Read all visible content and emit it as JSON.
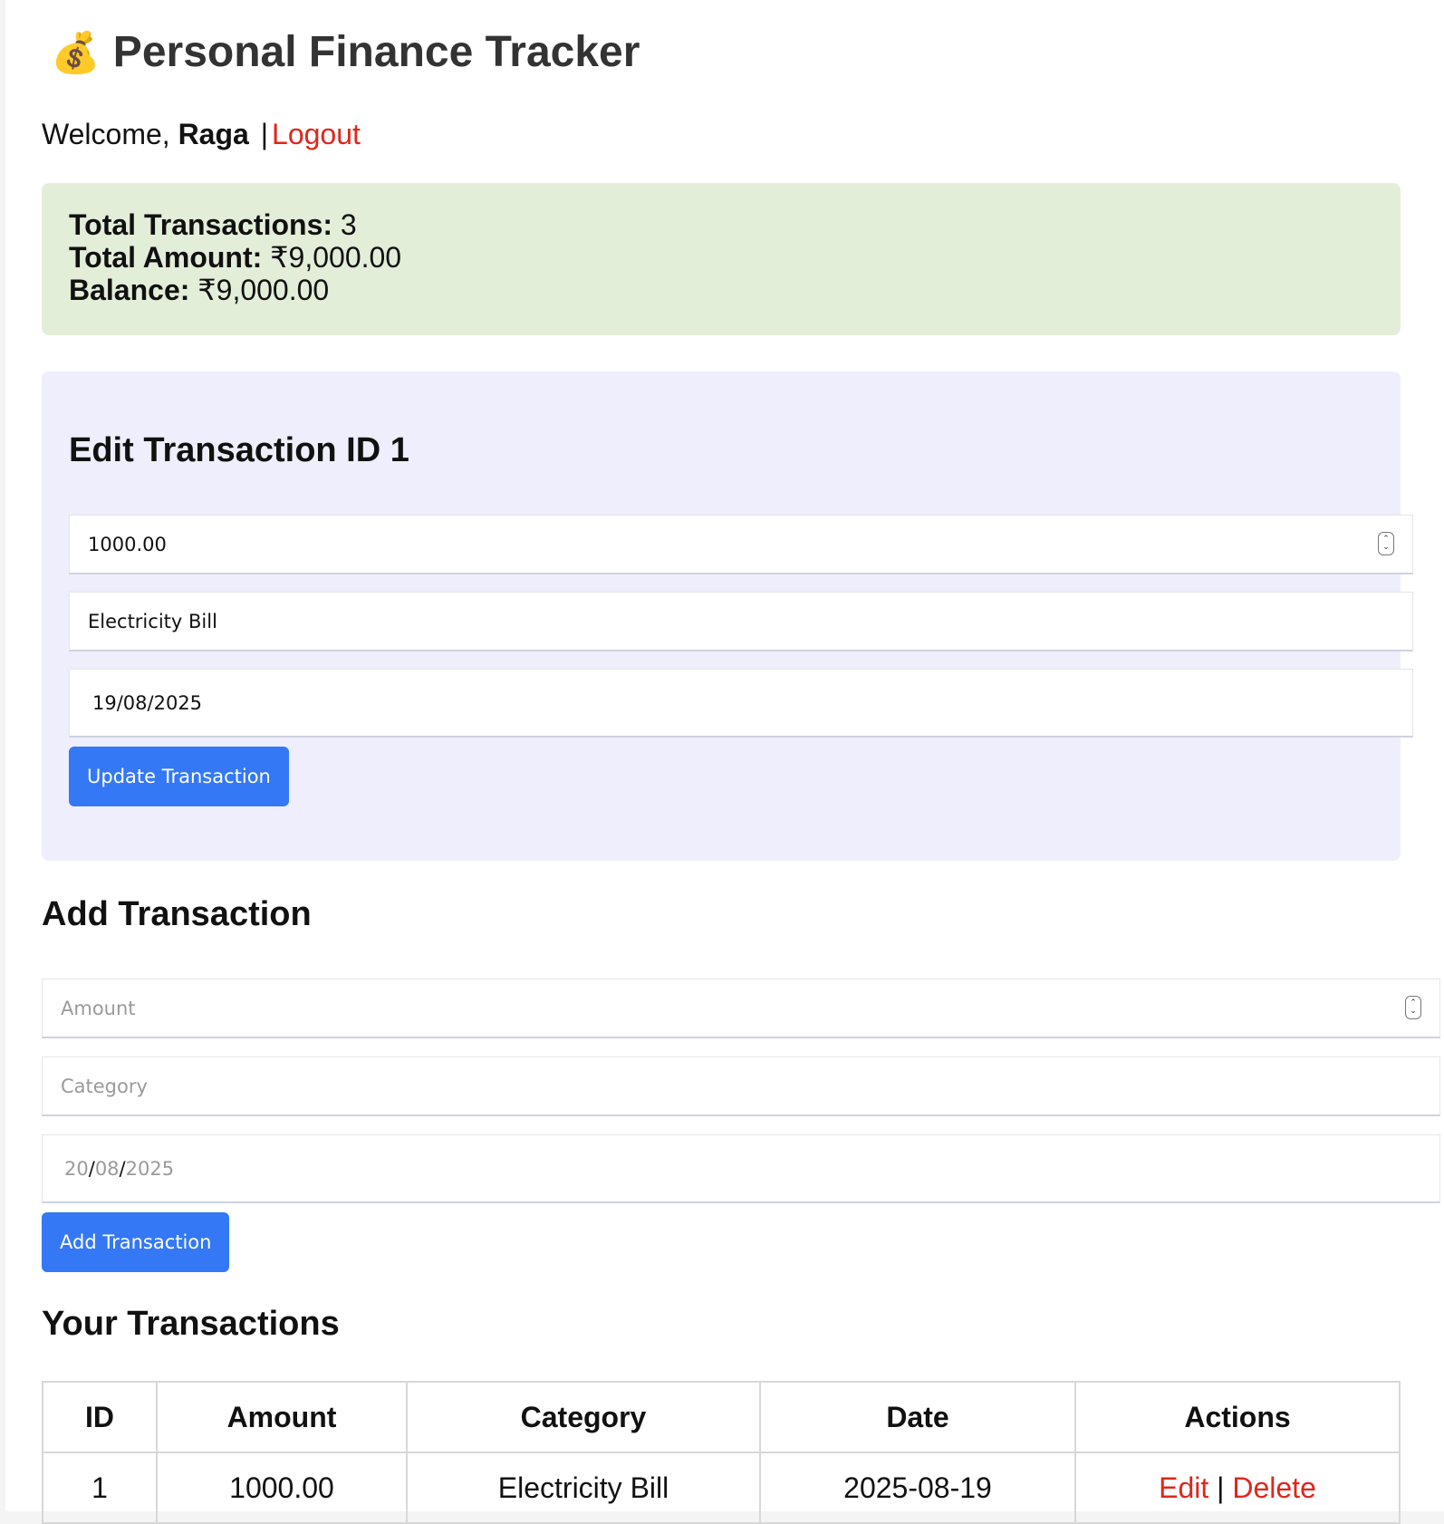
{
  "app": {
    "title": "Personal Finance Tracker",
    "title_icon": "money-bag-icon"
  },
  "welcome": {
    "prefix": "Welcome,",
    "username": "Raga",
    "separator": "|",
    "logout_label": "Logout"
  },
  "summary": {
    "total_transactions_label": "Total Transactions:",
    "total_transactions_value": "3",
    "total_amount_label": "Total Amount:",
    "total_amount_value": "₹9,000.00",
    "balance_label": "Balance:",
    "balance_value": "₹9,000.00"
  },
  "edit_form": {
    "title": "Edit Transaction ID 1",
    "amount_value": "1000.00",
    "category_value": "Electricity Bill",
    "date_value": "19/08/2025",
    "submit_label": "Update Transaction"
  },
  "add_form": {
    "title": "Add Transaction",
    "amount_placeholder": "Amount",
    "category_placeholder": "Category",
    "date_day": "20",
    "date_month": "08",
    "date_year": "2025",
    "date_separator": "/",
    "submit_label": "Add Transaction"
  },
  "transactions": {
    "title": "Your Transactions",
    "headers": [
      "ID",
      "Amount",
      "Category",
      "Date",
      "Actions"
    ],
    "rows": [
      {
        "id": "1",
        "amount": "1000.00",
        "category": "Electricity Bill",
        "date": "2025-08-19",
        "edit_label": "Edit",
        "action_separator": "|",
        "delete_label": "Delete"
      }
    ]
  },
  "colors": {
    "summary_bg": "#e3eed9",
    "edit_panel_bg": "#eeeefd",
    "button_bg": "#3478f6",
    "link_red": "#e0261b"
  }
}
